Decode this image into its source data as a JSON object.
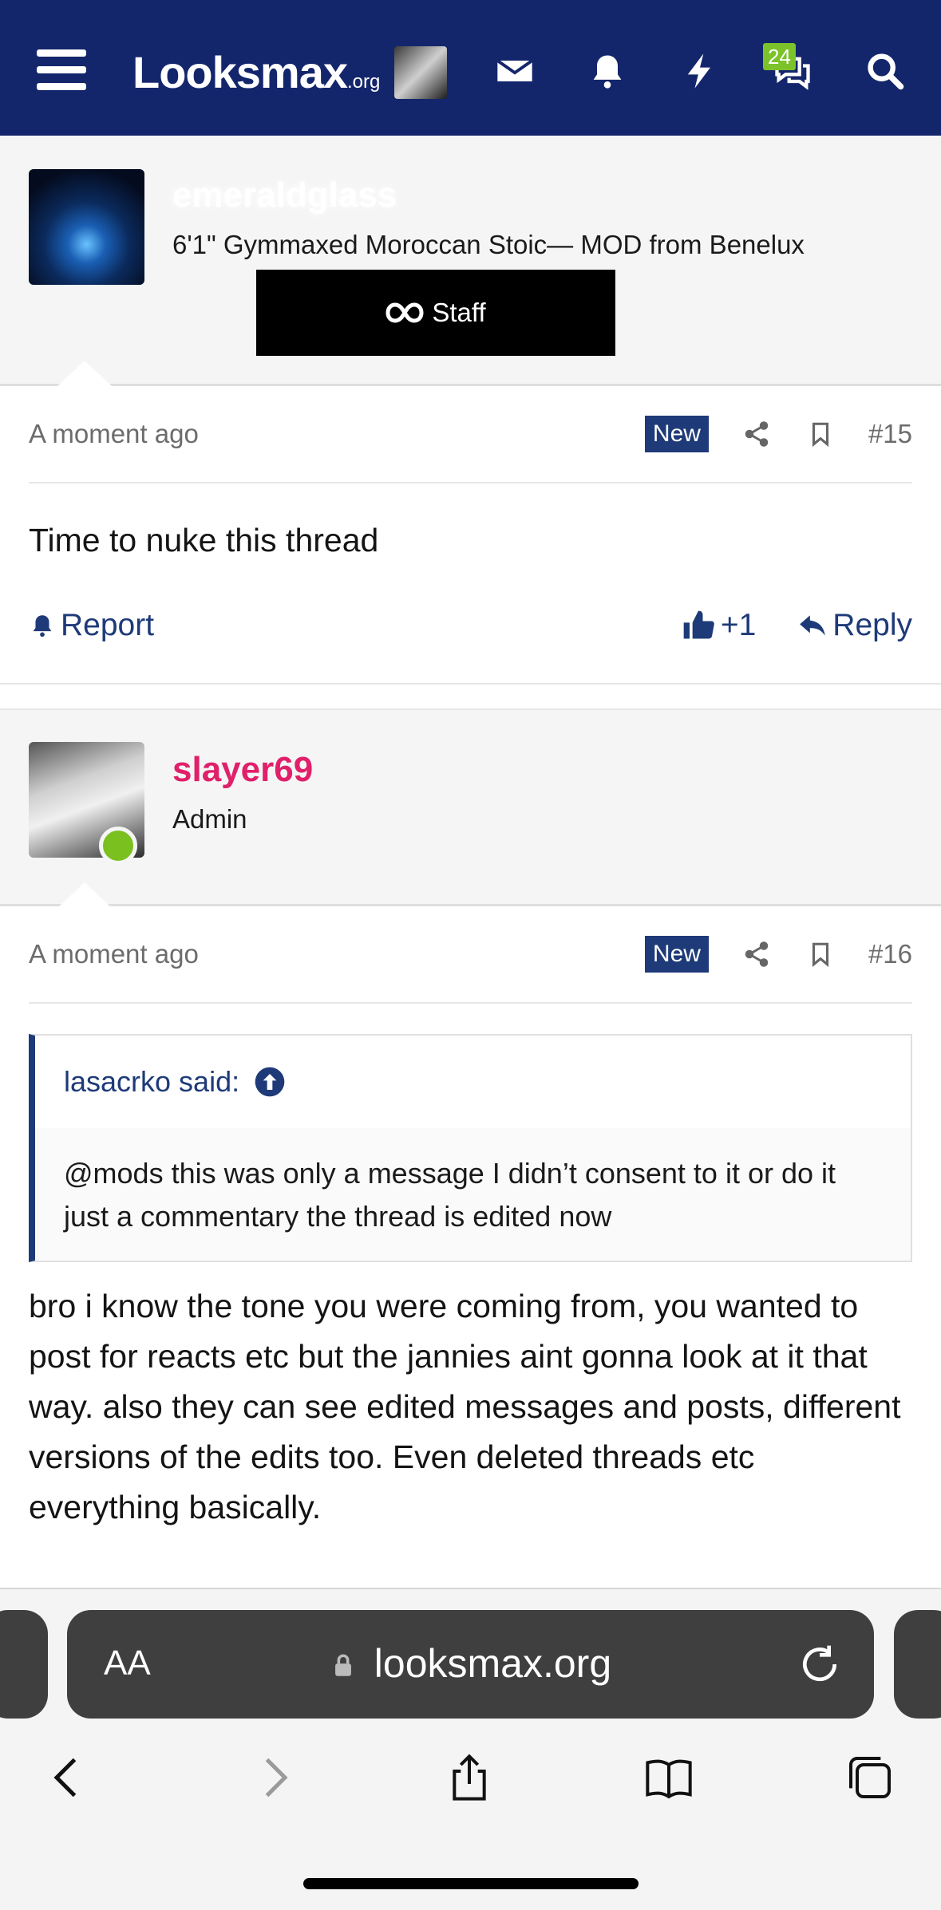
{
  "header": {
    "logo_text": "Looksmax",
    "logo_tld": ".org",
    "conversations_count": "24"
  },
  "posts": [
    {
      "username": "emeraldglass",
      "user_title": "6'1\" Gymmaxed Moroccan Stoic— MOD from Benelux",
      "banner": "Staff",
      "time": "A moment ago",
      "badge": "New",
      "number": "#15",
      "body": "Time to nuke this thread",
      "report_label": "Report",
      "reaction_count": "+1",
      "reply_label": "Reply"
    },
    {
      "username": "slayer69",
      "user_title": "Admin",
      "time": "A moment ago",
      "badge": "New",
      "number": "#16",
      "quote_author": "lasacrko said:",
      "quote_text": "@mods this was only a message I didn’t consent to it or do it just a commentary the thread is edited now",
      "body": "bro i know the tone you were coming from, you wanted to post for reacts etc but the jannies aint gonna look at it that way. also they can see edited messages and posts, different versions of the edits too. Even deleted threads etc everything basically."
    }
  ],
  "browser": {
    "text_size_label": "AA",
    "url": "looksmax.org"
  },
  "colors": {
    "nav_bg": "#14266b",
    "accent": "#1e3a78",
    "admin_name": "#e0206a",
    "online": "#7ac01f",
    "badge_green": "#7cc22a"
  },
  "icons": [
    "menu-icon",
    "mail-icon",
    "bell-icon",
    "bolt-icon",
    "conversations-icon",
    "search-icon",
    "share-icon",
    "bookmark-icon",
    "bell-report-icon",
    "thumbs-up-icon",
    "reply-icon",
    "quote-up-icon",
    "lock-icon",
    "reload-icon",
    "back-icon",
    "forward-icon",
    "share-sheet-icon",
    "bookmarks-icon",
    "tabs-icon"
  ]
}
